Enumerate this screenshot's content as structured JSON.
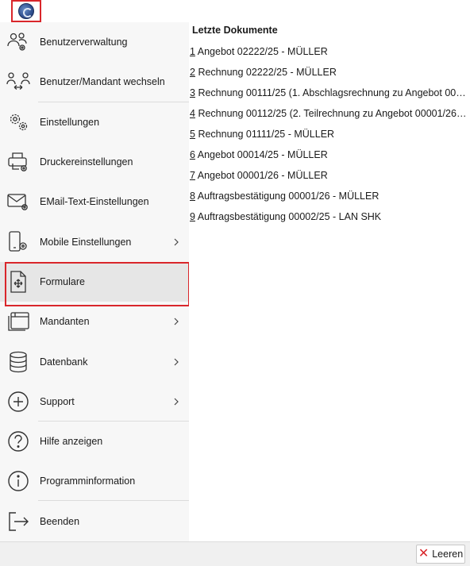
{
  "menu": {
    "items": [
      {
        "label": "Benutzerverwaltung",
        "icon": "users-gear-icon"
      },
      {
        "label": "Benutzer/Mandant wechseln",
        "icon": "switch-user-icon"
      },
      {
        "label": "Einstellungen",
        "icon": "gears-icon"
      },
      {
        "label": "Druckereinstellungen",
        "icon": "printer-gear-icon"
      },
      {
        "label": "EMail-Text-Einstellungen",
        "icon": "mail-gear-icon"
      },
      {
        "label": "Mobile Einstellungen",
        "icon": "mobile-gear-icon",
        "has_submenu": true
      },
      {
        "label": "Formulare",
        "icon": "form-document-icon",
        "highlighted": true
      },
      {
        "label": "Mandanten",
        "icon": "window-stack-icon",
        "has_submenu": true
      },
      {
        "label": "Datenbank",
        "icon": "database-icon",
        "has_submenu": true
      },
      {
        "label": "Support",
        "icon": "plus-circle-icon",
        "has_submenu": true
      },
      {
        "label": "Hilfe anzeigen",
        "icon": "help-circle-icon"
      },
      {
        "label": "Programminformation",
        "icon": "info-circle-icon"
      },
      {
        "label": "Beenden",
        "icon": "exit-icon"
      }
    ]
  },
  "recent": {
    "title": "Letzte Dokumente",
    "documents": [
      {
        "num": "1",
        "text": "Angebot 02222/25 - MÜLLER"
      },
      {
        "num": "2",
        "text": "Rechnung 02222/25 - MÜLLER"
      },
      {
        "num": "3",
        "text": "Rechnung 00111/25 (1. Abschlagsrechnung zu Angebot 00001/..."
      },
      {
        "num": "4",
        "text": "Rechnung 00112/25 (2. Teilrechnung zu Angebot 00001/26) - M..."
      },
      {
        "num": "5",
        "text": "Rechnung 01111/25 - MÜLLER"
      },
      {
        "num": "6",
        "text": "Angebot 00014/25 - MÜLLER"
      },
      {
        "num": "7",
        "text": "Angebot 00001/26 - MÜLLER"
      },
      {
        "num": "8",
        "text": "Auftragsbestätigung 00001/26 - MÜLLER"
      },
      {
        "num": "9",
        "text": "Auftragsbestätigung 00002/25 - LAN SHK"
      }
    ]
  },
  "bottom": {
    "clear_label": "Leeren"
  },
  "colors": {
    "accent_red": "#d9262b",
    "menu_bg": "#f7f7f7",
    "highlight_bg": "#e6e6e6"
  }
}
